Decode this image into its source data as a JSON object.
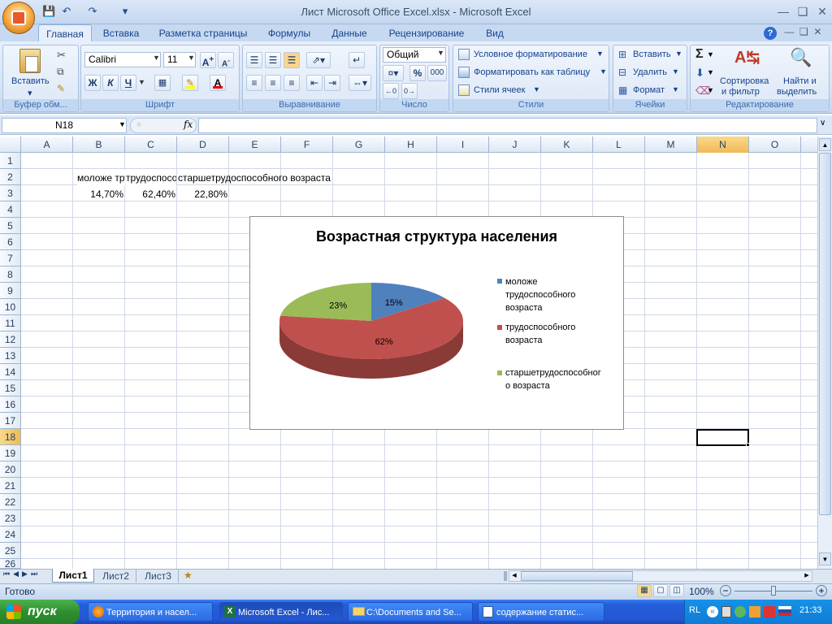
{
  "window": {
    "title": "Лист Microsoft Office Excel.xlsx - Microsoft Excel"
  },
  "ribbon_tabs": [
    "Главная",
    "Вставка",
    "Разметка страницы",
    "Формулы",
    "Данные",
    "Рецензирование",
    "Вид"
  ],
  "ribbon": {
    "clipboard": {
      "paste_label": "Вставить",
      "title": "Буфер обм..."
    },
    "font": {
      "font_name": "Calibri",
      "font_size": "11",
      "bold": "Ж",
      "italic": "К",
      "underline": "Ч",
      "title": "Шрифт"
    },
    "alignment": {
      "title": "Выравнивание"
    },
    "number": {
      "format": "Общий",
      "percent": "%",
      "thousands": "000",
      "title": "Число"
    },
    "styles": {
      "conditional": "Условное форматирование",
      "as_table": "Форматировать как таблицу",
      "cell_styles": "Стили ячеек",
      "title": "Стили"
    },
    "cells": {
      "insert": "Вставить",
      "delete": "Удалить",
      "format": "Формат",
      "title": "Ячейки"
    },
    "editing": {
      "sort_l1": "Сортировка",
      "sort_l2": "и фильтр",
      "find_l1": "Найти и",
      "find_l2": "выделить",
      "title": "Редактирование"
    }
  },
  "formula_bar": {
    "name_box": "N18",
    "fx": "fx",
    "formula": ""
  },
  "columns": [
    "A",
    "B",
    "C",
    "D",
    "E",
    "F",
    "G",
    "H",
    "I",
    "J",
    "K",
    "L",
    "M",
    "N",
    "O"
  ],
  "rows": [
    "1",
    "2",
    "3",
    "4",
    "5",
    "6",
    "7",
    "8",
    "9",
    "10",
    "11",
    "12",
    "13",
    "14",
    "15",
    "16",
    "17",
    "18",
    "19",
    "20",
    "21",
    "22",
    "23",
    "24",
    "25",
    "26"
  ],
  "cells": {
    "B2": "моложе трудоспособного возраста",
    "C2": "трудоспособного возраста",
    "D2": "старшетрудоспособного возраста",
    "B3": "14,70%",
    "C3": "62,40%",
    "D3": "22,80%"
  },
  "chart_data": {
    "type": "pie",
    "title": "Возрастная структура населения",
    "categories": [
      "моложе трудоспособного возраста",
      "трудоспособного возраста",
      "старшетрудоспособного возраста"
    ],
    "values": [
      14.7,
      62.4,
      22.8
    ],
    "data_labels": [
      "15%",
      "62%",
      "23%"
    ],
    "colors": [
      "#4f81bd",
      "#c0504d",
      "#9bbb59"
    ],
    "legend_placement": "right",
    "style": "3d"
  },
  "legend_lines": {
    "item1": [
      "моложе",
      "трудоспособного",
      "возраста"
    ],
    "item2": [
      "трудоспособного",
      "возраста"
    ],
    "item3": [
      "старшетрудоспособног",
      "о возраста"
    ]
  },
  "sheet_tabs": [
    "Лист1",
    "Лист2",
    "Лист3"
  ],
  "status": {
    "ready": "Готово",
    "zoom": "100%"
  },
  "taskbar": {
    "start": "пуск",
    "buttons": [
      "Территория и насел...",
      "Microsoft Excel - Лис...",
      "C:\\Documents and Se...",
      "содержание статис..."
    ],
    "lang": "RL",
    "clock": "21:33"
  }
}
